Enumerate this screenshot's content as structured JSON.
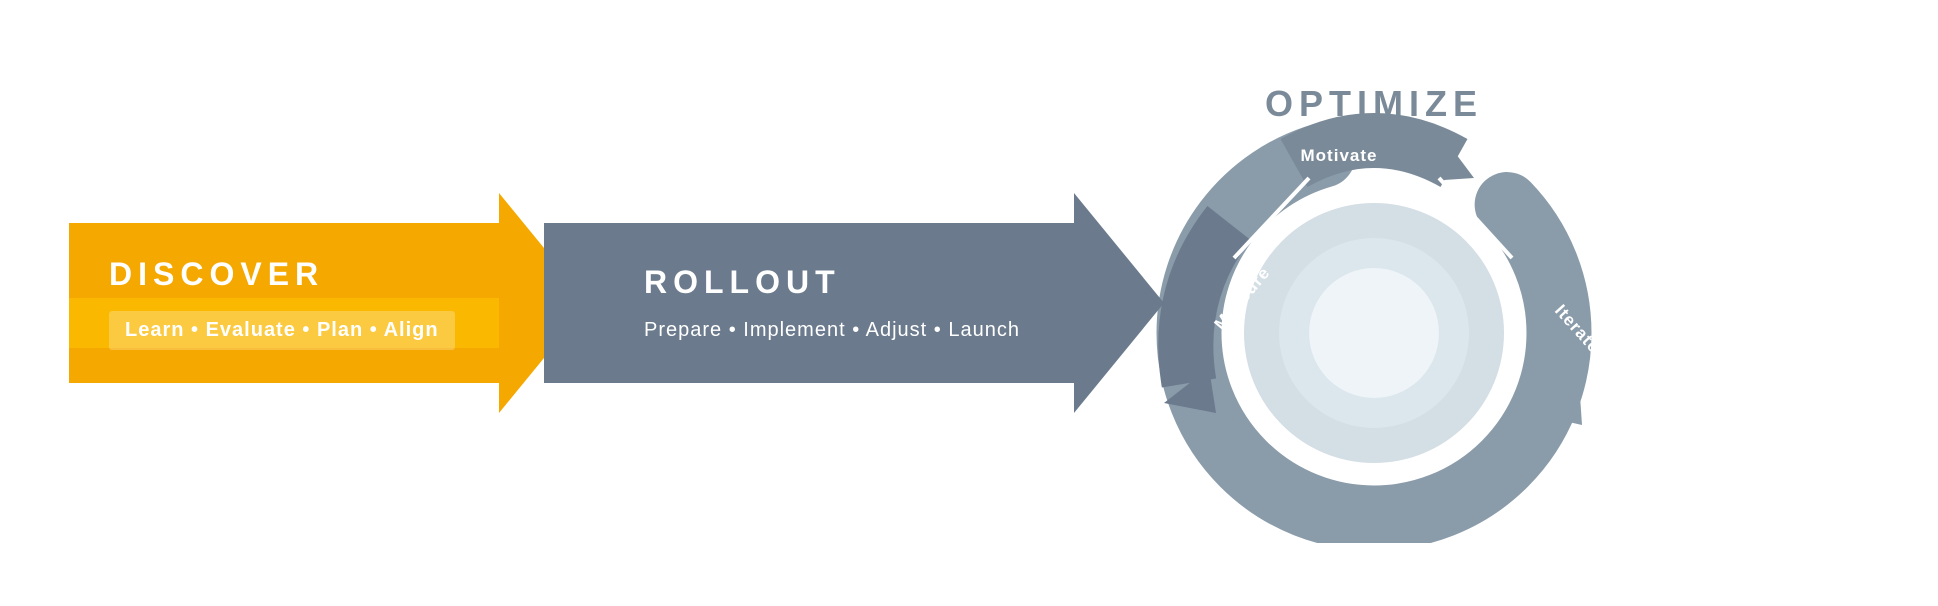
{
  "discover": {
    "title": "DISCOVER",
    "subtitle": "Learn  •  Evaluate  •  Plan  •  Align",
    "color": "#F5A800",
    "color_dark": "#E09600"
  },
  "rollout": {
    "title": "ROLLOUT",
    "subtitle": "Prepare  •  Implement  •  Adjust  •  Launch",
    "color": "#6b7b8d",
    "color_dark": "#5a6a7a"
  },
  "optimize": {
    "title": "OPTIMIZE",
    "measure": "Measure",
    "motivate": "Motivate",
    "iterate": "Iterate",
    "color_outer": "#8a9baa",
    "color_inner": "#aabbc8",
    "color_circle": "#c5d4de"
  }
}
